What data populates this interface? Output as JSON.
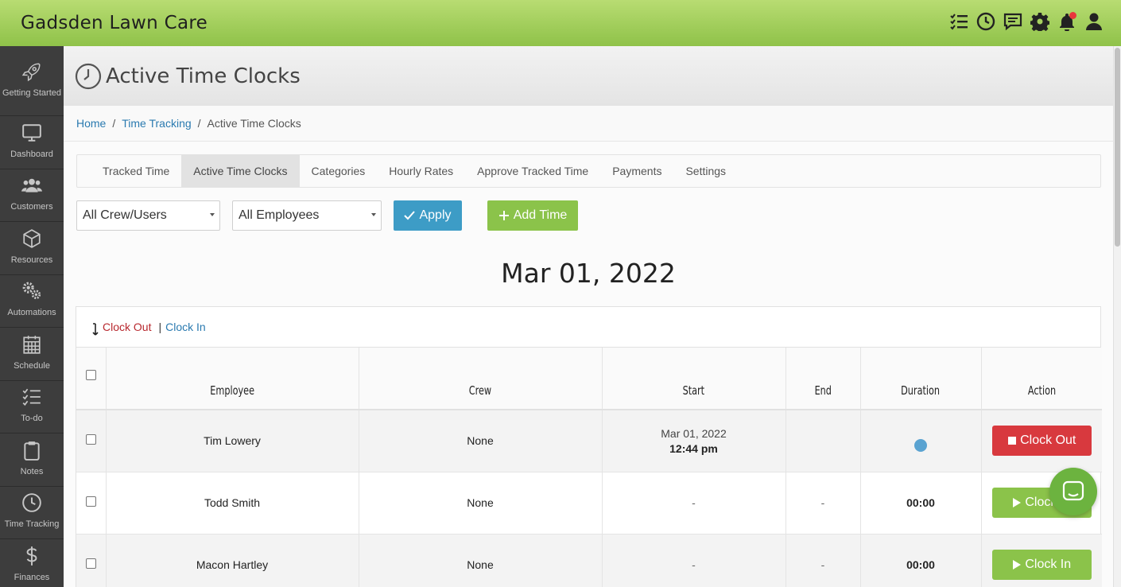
{
  "app": {
    "brand": "Gadsden Lawn Care",
    "accent_color": "#8fc249",
    "top_icons": [
      "task-list-icon",
      "clock-icon",
      "chat-icon",
      "gear-icon",
      "bell-icon",
      "user-icon"
    ]
  },
  "sidebar": {
    "items": [
      {
        "label": "Getting Started",
        "icon": "rocket-icon"
      },
      {
        "label": "Dashboard",
        "icon": "monitor-icon"
      },
      {
        "label": "Customers",
        "icon": "users-icon"
      },
      {
        "label": "Resources",
        "icon": "box-icon"
      },
      {
        "label": "Automations",
        "icon": "gears-icon"
      },
      {
        "label": "Schedule",
        "icon": "calendar-icon"
      },
      {
        "label": "To-do",
        "icon": "checklist-icon"
      },
      {
        "label": "Notes",
        "icon": "clipboard-icon"
      },
      {
        "label": "Time Tracking",
        "icon": "clock-icon"
      },
      {
        "label": "Finances",
        "icon": "dollar-icon"
      }
    ]
  },
  "header": {
    "title": "Active Time Clocks"
  },
  "breadcrumb": {
    "home": "Home",
    "sep": "/",
    "section": "Time Tracking",
    "current": "Active Time Clocks"
  },
  "tabs": [
    {
      "label": "Tracked Time"
    },
    {
      "label": "Active Time Clocks",
      "active": true
    },
    {
      "label": "Categories"
    },
    {
      "label": "Hourly Rates"
    },
    {
      "label": "Approve Tracked Time"
    },
    {
      "label": "Payments"
    },
    {
      "label": "Settings"
    }
  ],
  "filters": {
    "crew_select": "All Crew/Users",
    "employee_select": "All Employees",
    "apply_label": "Apply",
    "add_time_label": "Add Time"
  },
  "date_title": "Mar 01, 2022",
  "legend": {
    "clock_out": "Clock Out",
    "separator": "|",
    "clock_in": "Clock In"
  },
  "table": {
    "headers": [
      "Employee",
      "Crew",
      "Start",
      "End",
      "Duration",
      "Action"
    ],
    "rows": [
      {
        "employee": "Tim Lowery",
        "crew": "None",
        "start_date": "Mar 01, 2022",
        "start_time": "12:44 pm",
        "end": "",
        "duration": "",
        "action": "Clock Out"
      },
      {
        "employee": "Todd Smith",
        "crew": "None",
        "start_date": "-",
        "start_time": "",
        "end": "-",
        "duration": "00:00",
        "action": "Clock In"
      },
      {
        "employee": "Macon Hartley",
        "crew": "None",
        "start_date": "-",
        "start_time": "",
        "end": "-",
        "duration": "00:00",
        "action": "Clock In"
      }
    ]
  }
}
